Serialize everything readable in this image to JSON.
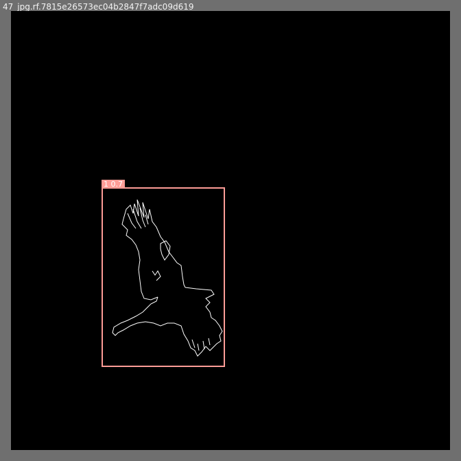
{
  "image": {
    "filename": "47_jpg.rf.7815e26573ec04b2847f7adc09d619"
  },
  "detection": {
    "label": "1 0.7",
    "color": "#ff9d97"
  },
  "figure": {
    "icon": "bird-silhouette-icon",
    "stroke_color": "#ffffff"
  }
}
